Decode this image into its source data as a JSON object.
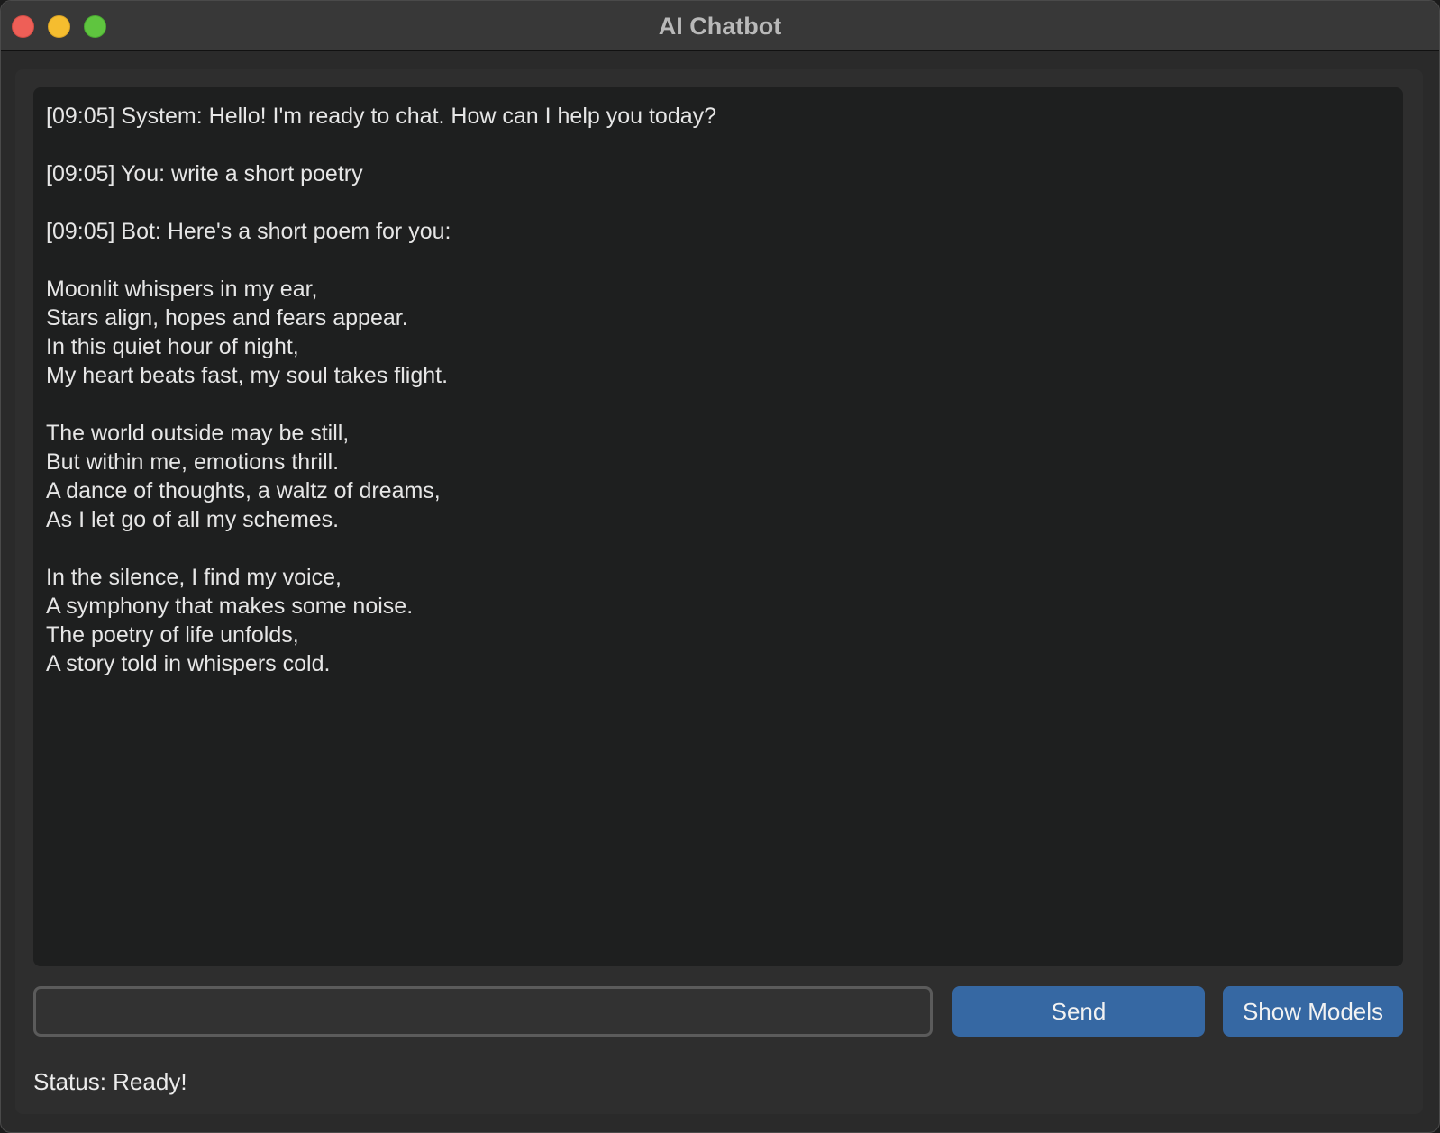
{
  "window": {
    "title": "AI Chatbot"
  },
  "chat": {
    "lines": [
      "[09:05] System: Hello! I'm ready to chat. How can I help you today?",
      "",
      "[09:05] You: write a short poetry",
      "",
      "[09:05] Bot: Here's a short poem for you:",
      "",
      "Moonlit whispers in my ear,",
      "Stars align, hopes and fears appear.",
      "In this quiet hour of night,",
      "My heart beats fast, my soul takes flight.",
      "",
      "The world outside may be still,",
      "But within me, emotions thrill.",
      "A dance of thoughts, a waltz of dreams,",
      "As I let go of all my schemes.",
      "",
      "In the silence, I find my voice,",
      "A symphony that makes some noise.",
      "The poetry of life unfolds,",
      "A story told in whispers cold."
    ]
  },
  "input": {
    "value": "",
    "placeholder": ""
  },
  "buttons": {
    "send_label": "Send",
    "models_label": "Show Models"
  },
  "status": {
    "text": "Status: Ready!"
  },
  "colors": {
    "accent": "#3668a3",
    "chat_background": "#1e1f1f",
    "window_background": "#2e2e2e"
  }
}
